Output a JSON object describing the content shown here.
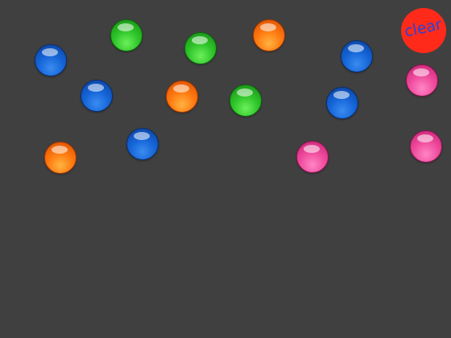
{
  "clear_button": {
    "label": "clear",
    "color": "#ff2a1a",
    "text_color": "#2a44d8"
  },
  "background_color": "#404040",
  "balls": [
    {
      "color": "blue"
    },
    {
      "color": "green"
    },
    {
      "color": "green"
    },
    {
      "color": "orange"
    },
    {
      "color": "blue"
    },
    {
      "color": "pink"
    },
    {
      "color": "blue"
    },
    {
      "color": "orange"
    },
    {
      "color": "green"
    },
    {
      "color": "blue"
    },
    {
      "color": "blue"
    },
    {
      "color": "orange"
    },
    {
      "color": "pink"
    },
    {
      "color": "pink"
    }
  ]
}
